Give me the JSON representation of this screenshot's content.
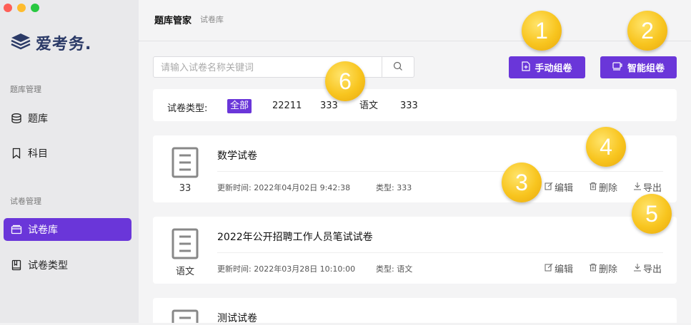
{
  "sidebar": {
    "logo_text": "爱考务.",
    "section1": "题库管理",
    "items1": [
      {
        "label": "题库",
        "icon": "database-icon"
      },
      {
        "label": "科目",
        "icon": "bookmark-icon"
      }
    ],
    "section2": "试卷管理",
    "items2": [
      {
        "label": "试卷库",
        "icon": "folder-icon",
        "active": true
      },
      {
        "label": "试卷类型",
        "icon": "book-icon"
      }
    ]
  },
  "header": {
    "title": "题库管家",
    "subtitle": "试卷库"
  },
  "search": {
    "placeholder": "请输入试卷名称关键词",
    "value": ""
  },
  "toolbar": {
    "manual_label": "手动组卷",
    "smart_label": "智能组卷"
  },
  "filter": {
    "label": "试卷类型:",
    "options": [
      "全部",
      "22211",
      "333",
      "语文",
      "333"
    ],
    "selected": "全部"
  },
  "papers": [
    {
      "type": "33",
      "title": "数学试卷",
      "updated": "更新时间: 2022年04月02日 9:42:38",
      "type_meta": "类型: 333"
    },
    {
      "type": "语文",
      "title": "2022年公开招聘工作人员笔试试卷",
      "updated": "更新时间: 2022年03月28日 10:10:00",
      "type_meta": "类型: 语文"
    },
    {
      "type": "",
      "title": "测试试卷",
      "updated": "",
      "type_meta": ""
    }
  ],
  "actions": {
    "edit": "编辑",
    "delete": "删除",
    "export": "导出"
  },
  "callouts": [
    "1",
    "2",
    "3",
    "4",
    "5",
    "6"
  ],
  "colors": {
    "accent": "#6a36d9",
    "badge": "#f8c51f",
    "sidebar_bg": "#e9e9eb"
  }
}
